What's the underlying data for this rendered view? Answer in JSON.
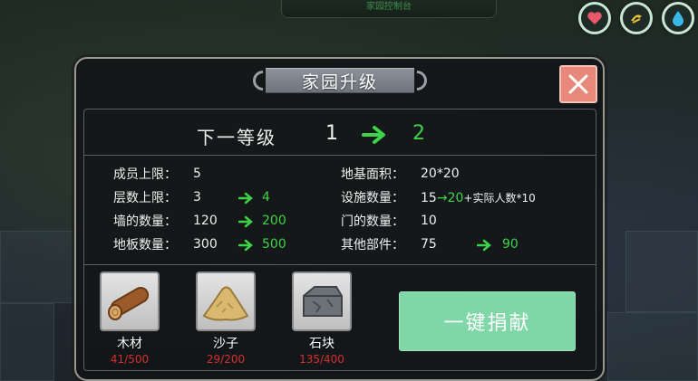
{
  "console": {
    "label": "家园控制台"
  },
  "status_icons": [
    {
      "name": "heart-icon",
      "color": "#e85a6a"
    },
    {
      "name": "hunger-icon",
      "color": "#e8c43a"
    },
    {
      "name": "water-drop-icon",
      "color": "#3ab8e8"
    }
  ],
  "dialog": {
    "title": "家园升级",
    "level": {
      "label": "下一等级",
      "current": "1",
      "next": "2"
    },
    "stats_left": [
      {
        "label": "成员上限：",
        "value": "5",
        "next": ""
      },
      {
        "label": "层数上限：",
        "value": "3",
        "next": "4"
      },
      {
        "label": "墙的数量：",
        "value": "120",
        "next": "200"
      },
      {
        "label": "地板数量：",
        "value": "300",
        "next": "500"
      }
    ],
    "stats_right": [
      {
        "label": "地基面积：",
        "value": "20*20",
        "next": ""
      },
      {
        "label": "设施数量：",
        "value": "15",
        "next": "20",
        "suffix": "+实际人数*10"
      },
      {
        "label": "门的数量：",
        "value": "10",
        "next": ""
      },
      {
        "label": "其他部件：",
        "value": "75",
        "next": "90"
      }
    ],
    "materials": [
      {
        "name": "木材",
        "count": "41/500",
        "icon": "wood-log-icon"
      },
      {
        "name": "沙子",
        "count": "29/200",
        "icon": "sand-pile-icon"
      },
      {
        "name": "石块",
        "count": "135/400",
        "icon": "stone-block-icon"
      }
    ],
    "donate_label": "一键捐献"
  },
  "colors": {
    "accent_green": "#3fd24a",
    "donate_button": "#7fd6a6",
    "close_button": "#e8887a",
    "shortage_red": "#d42f2f"
  }
}
